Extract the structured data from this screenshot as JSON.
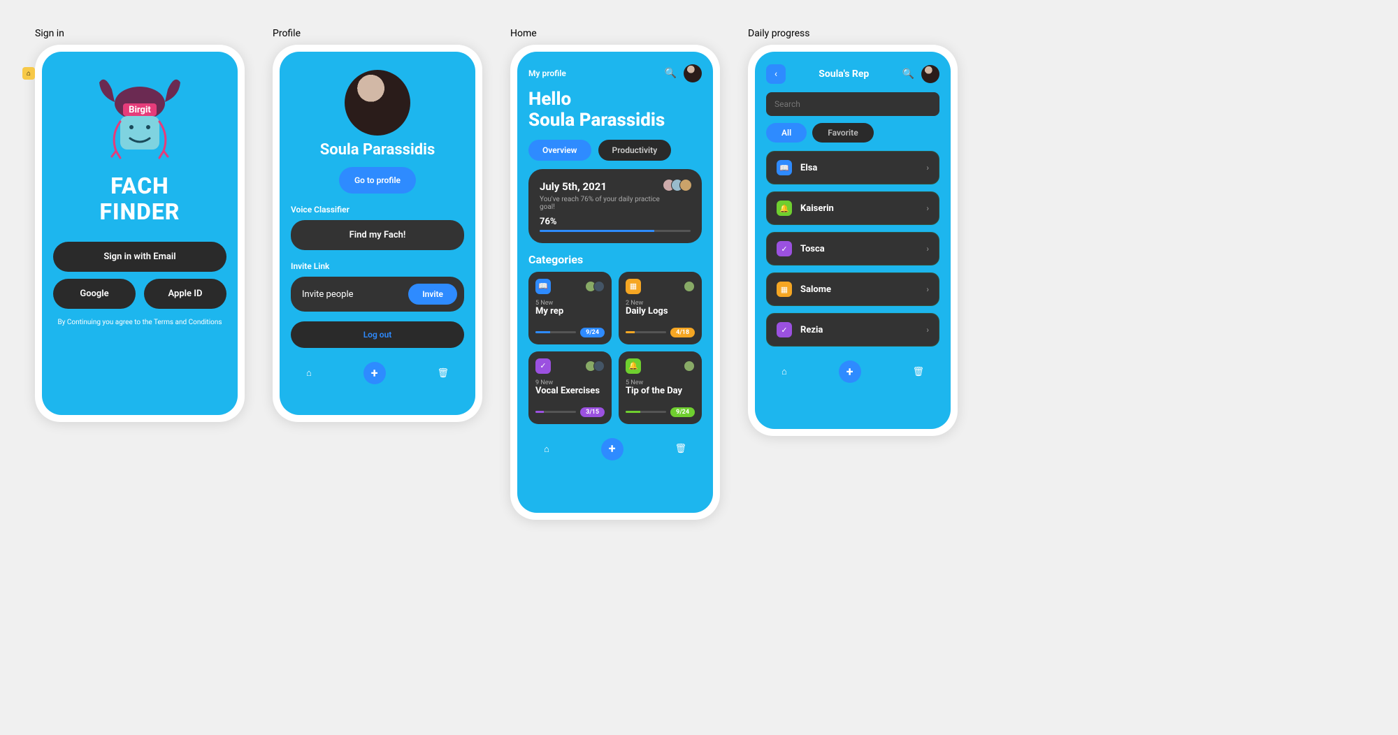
{
  "signin": {
    "label": "Sign in",
    "logo_name": "Birgit",
    "title_l1": "FACH",
    "title_l2": "FINDER",
    "email_btn": "Sign in with Email",
    "google_btn": "Google",
    "apple_btn": "Apple ID",
    "terms": "By Continuing you agree to the Terms and Conditions"
  },
  "profile": {
    "label": "Profile",
    "name": "Soula Parassidis",
    "goto": "Go to profile",
    "vc_label": "Voice Classifier",
    "find": "Find my Fach!",
    "inv_label": "Invite Link",
    "inv_text": "Invite people",
    "inv_btn": "Invite",
    "logout": "Log out"
  },
  "home": {
    "label": "Home",
    "myprofile": "My profile",
    "hello": "Hello",
    "name": "Soula Parassidis",
    "tabs": {
      "overview": "Overview",
      "prod": "Productivity"
    },
    "progress": {
      "date": "July 5th, 2021",
      "msg": "You've reach 76% of your daily practice goal!",
      "pct_label": "76%",
      "pct": 76
    },
    "cat_h": "Categories",
    "tiles": [
      {
        "new": "5 New",
        "title": "My rep",
        "ratio": "9/24",
        "fill": 36,
        "cls": "b",
        "ic": "book",
        "glyph": "📖",
        "avs": 2
      },
      {
        "new": "2 New",
        "title": "Daily Logs",
        "ratio": "4/18",
        "fill": 22,
        "cls": "o",
        "ic": "box",
        "glyph": "▦",
        "avs": 1
      },
      {
        "new": "9 New",
        "title": "Vocal Exercises",
        "ratio": "3/15",
        "fill": 20,
        "cls": "p",
        "ic": "chk",
        "glyph": "✓",
        "avs": 2
      },
      {
        "new": "5 New",
        "title": "Tip of the Day",
        "ratio": "9/24",
        "fill": 36,
        "cls": "g",
        "ic": "bell",
        "glyph": "🔔",
        "avs": 1
      }
    ]
  },
  "daily": {
    "label": "Daily progress",
    "title": "Soula's Rep",
    "search_ph": "Search",
    "chips": {
      "all": "All",
      "fav": "Favorite"
    },
    "items": [
      {
        "name": "Elsa",
        "cls": "book",
        "glyph": "📖"
      },
      {
        "name": "Kaiserin",
        "cls": "bell",
        "glyph": "🔔"
      },
      {
        "name": "Tosca",
        "cls": "chk",
        "glyph": "✓"
      },
      {
        "name": "Salome",
        "cls": "box",
        "glyph": "▦"
      },
      {
        "name": "Rezia",
        "cls": "chk",
        "glyph": "✓"
      }
    ]
  }
}
